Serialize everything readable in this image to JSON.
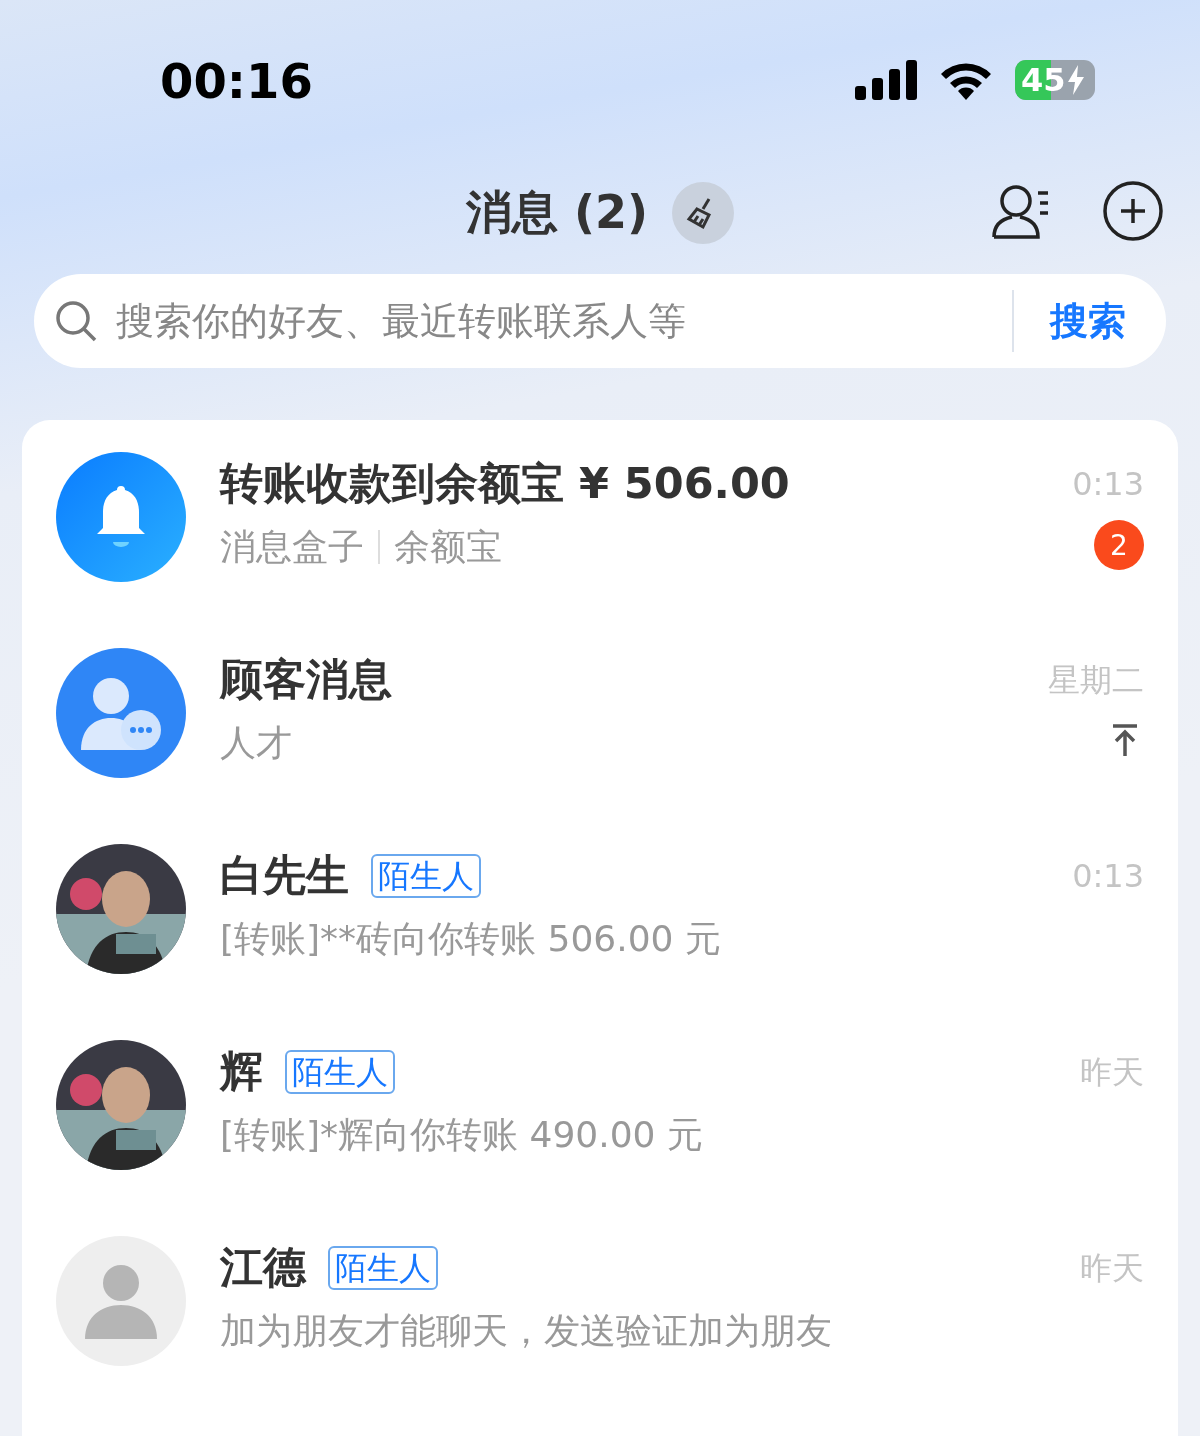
{
  "status_bar": {
    "time": "00:16",
    "battery": "45",
    "charging": true
  },
  "header": {
    "title": "消息 (2)"
  },
  "search": {
    "placeholder": "搜索你的好友、最近转账联系人等",
    "button": "搜索"
  },
  "messages": [
    {
      "kind": "bell",
      "title": "转账收款到余额宝 ¥ 506.00",
      "subtitle": [
        "消息盒子",
        "余额宝"
      ],
      "time": "0:13",
      "badge": "2",
      "pinned": false
    },
    {
      "kind": "customer",
      "title": "顾客消息",
      "subtitle": [
        "人才"
      ],
      "time": "星期二",
      "pinned": true
    },
    {
      "title": "白先生",
      "tag": "陌生人",
      "subtitle": [
        "[转账]**砖向你转账 506.00 元"
      ],
      "time": "0:13",
      "pinned": false
    },
    {
      "title": "辉",
      "tag": "陌生人",
      "subtitle": [
        "[转账]*辉向你转账 490.00 元"
      ],
      "time": "昨天",
      "pinned": false
    },
    {
      "kind": "default",
      "title": "江德",
      "tag": "陌生人",
      "subtitle": [
        "加为朋友才能聊天，发送验证加为朋友"
      ],
      "time": "昨天",
      "pinned": false
    }
  ]
}
